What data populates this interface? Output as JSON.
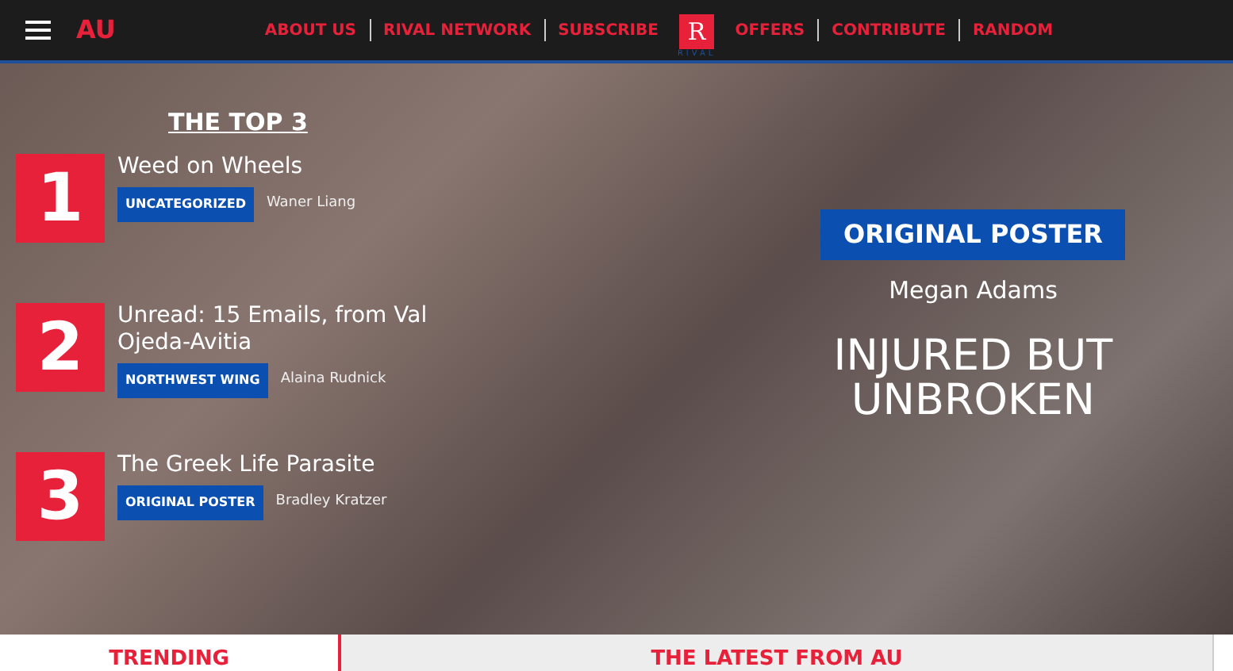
{
  "navbar": {
    "site_title": "AU",
    "links": [
      {
        "label": "ABOUT US"
      },
      {
        "label": "RIVAL NETWORK"
      },
      {
        "label": "SUBSCRIBE"
      },
      {
        "kind": "logo",
        "label": "R",
        "caption": "RIVAL"
      },
      {
        "label": "OFFERS"
      },
      {
        "label": "CONTRIBUTE"
      },
      {
        "label": "RANDOM"
      }
    ]
  },
  "top3": {
    "heading": "THE TOP 3",
    "items": [
      {
        "rank": "1",
        "title": "Weed on Wheels",
        "category": "UNCATEGORIZED",
        "author": "Waner Liang"
      },
      {
        "rank": "2",
        "title": "Unread: 15 Emails, from Val Ojeda-Avitia",
        "category": "NORTHWEST WING",
        "author": "Alaina Rudnick"
      },
      {
        "rank": "3",
        "title": "The Greek Life Parasite",
        "category": "ORIGINAL POSTER",
        "author": "Bradley Kratzer"
      }
    ]
  },
  "feature": {
    "category": "ORIGINAL POSTER",
    "author": "Megan Adams",
    "title": "INJURED BUT UNBROKEN"
  },
  "tabs": [
    {
      "label": "TRENDING",
      "selected": true
    },
    {
      "label": "THE LATEST FROM AU",
      "selected": false
    }
  ]
}
